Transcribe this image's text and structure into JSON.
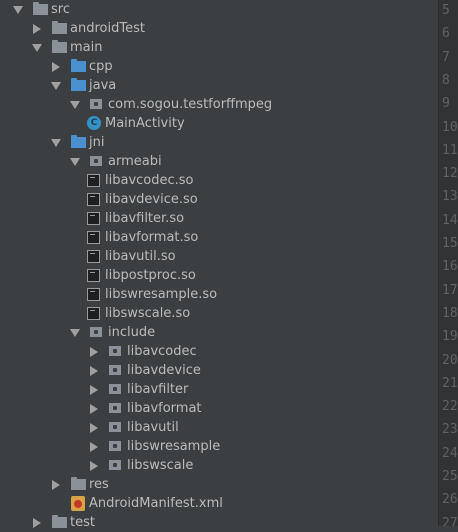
{
  "tree": [
    {
      "label": "src",
      "depth": 0,
      "state": "open",
      "icon": "folder-plain",
      "name": "folder-src"
    },
    {
      "label": "androidTest",
      "depth": 1,
      "state": "closed",
      "icon": "folder-plain",
      "name": "folder-androidTest"
    },
    {
      "label": "main",
      "depth": 1,
      "state": "open",
      "icon": "folder-plain",
      "name": "folder-main"
    },
    {
      "label": "cpp",
      "depth": 2,
      "state": "closed",
      "icon": "folder-src",
      "name": "folder-cpp"
    },
    {
      "label": "java",
      "depth": 2,
      "state": "open",
      "icon": "folder-src",
      "name": "folder-java"
    },
    {
      "label": "com.sogou.testforffmpeg",
      "depth": 3,
      "state": "open",
      "icon": "pkg",
      "name": "package-com-sogou-testforffmpeg"
    },
    {
      "label": "MainActivity",
      "depth": 4,
      "state": "none",
      "icon": "class",
      "name": "class-mainactivity"
    },
    {
      "label": "jni",
      "depth": 2,
      "state": "open",
      "icon": "folder-src",
      "name": "folder-jni"
    },
    {
      "label": "armeabi",
      "depth": 3,
      "state": "open",
      "icon": "pkg",
      "name": "folder-armeabi"
    },
    {
      "label": "libavcodec.so",
      "depth": 4,
      "state": "none",
      "icon": "so",
      "name": "file-libavcodec-so"
    },
    {
      "label": "libavdevice.so",
      "depth": 4,
      "state": "none",
      "icon": "so",
      "name": "file-libavdevice-so"
    },
    {
      "label": "libavfilter.so",
      "depth": 4,
      "state": "none",
      "icon": "so",
      "name": "file-libavfilter-so"
    },
    {
      "label": "libavformat.so",
      "depth": 4,
      "state": "none",
      "icon": "so",
      "name": "file-libavformat-so"
    },
    {
      "label": "libavutil.so",
      "depth": 4,
      "state": "none",
      "icon": "so",
      "name": "file-libavutil-so"
    },
    {
      "label": "libpostproc.so",
      "depth": 4,
      "state": "none",
      "icon": "so",
      "name": "file-libpostproc-so"
    },
    {
      "label": "libswresample.so",
      "depth": 4,
      "state": "none",
      "icon": "so",
      "name": "file-libswresample-so"
    },
    {
      "label": "libswscale.so",
      "depth": 4,
      "state": "none",
      "icon": "so",
      "name": "file-libswscale-so"
    },
    {
      "label": "include",
      "depth": 3,
      "state": "open",
      "icon": "pkg",
      "name": "folder-include"
    },
    {
      "label": "libavcodec",
      "depth": 4,
      "state": "closed",
      "icon": "pkg",
      "name": "folder-libavcodec"
    },
    {
      "label": "libavdevice",
      "depth": 4,
      "state": "closed",
      "icon": "pkg",
      "name": "folder-libavdevice"
    },
    {
      "label": "libavfilter",
      "depth": 4,
      "state": "closed",
      "icon": "pkg",
      "name": "folder-libavfilter"
    },
    {
      "label": "libavformat",
      "depth": 4,
      "state": "closed",
      "icon": "pkg",
      "name": "folder-libavformat"
    },
    {
      "label": "libavutil",
      "depth": 4,
      "state": "closed",
      "icon": "pkg",
      "name": "folder-libavutil"
    },
    {
      "label": "libswresample",
      "depth": 4,
      "state": "closed",
      "icon": "pkg",
      "name": "folder-libswresample"
    },
    {
      "label": "libswscale",
      "depth": 4,
      "state": "closed",
      "icon": "pkg",
      "name": "folder-libswscale"
    },
    {
      "label": "res",
      "depth": 2,
      "state": "closed",
      "icon": "folder-res",
      "name": "folder-res"
    },
    {
      "label": "AndroidManifest.xml",
      "depth": 2,
      "state": "none",
      "icon": "xml",
      "name": "file-androidmanifest-xml"
    },
    {
      "label": "test",
      "depth": 1,
      "state": "closed",
      "icon": "folder-plain",
      "name": "folder-test"
    }
  ],
  "gutter_lines": [
    "5",
    "6",
    "7",
    "8",
    "9",
    "10",
    "11",
    "12",
    "13",
    "14",
    "15",
    "16",
    "17",
    "18",
    "19",
    "20",
    "21",
    "22",
    "23",
    "24",
    "25",
    "26",
    "27"
  ],
  "class_icon_letter": "C",
  "colors": {
    "background": "#3c3f41",
    "text": "#bbbbbb",
    "source_folder": "#4a8fd0",
    "gutter": "#313335",
    "line_number": "#606366"
  }
}
